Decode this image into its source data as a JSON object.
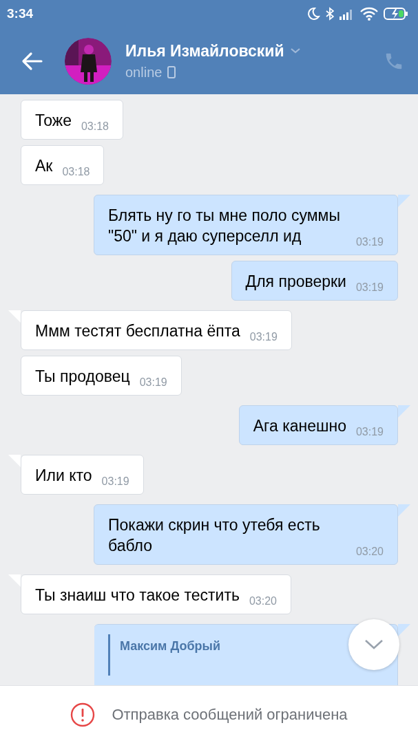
{
  "status_bar": {
    "time": "3:34"
  },
  "header": {
    "name": "Илья Измайловский",
    "status": "online"
  },
  "messages": [
    {
      "kind": "in",
      "text": "Тоже",
      "time": "03:18",
      "tail": false
    },
    {
      "kind": "in",
      "text": "Ак",
      "time": "03:18",
      "tail": false
    },
    {
      "kind": "out",
      "text": "Блять ну го ты мне поло суммы \"50\" и я даю суперселл ид",
      "time": "03:19",
      "tail": true
    },
    {
      "kind": "out",
      "text": "Для проверки",
      "time": "03:19",
      "tail": false
    },
    {
      "kind": "in",
      "text": "Ммм тестят бесплатна ёпта",
      "time": "03:19",
      "tail": true
    },
    {
      "kind": "in",
      "text": "Ты продовец",
      "time": "03:19",
      "tail": false
    },
    {
      "kind": "out",
      "text": "Ага канешно",
      "time": "03:19",
      "tail": true
    },
    {
      "kind": "in",
      "text": "Или кто",
      "time": "03:19",
      "tail": true
    },
    {
      "kind": "out",
      "text": "Покажи скрин что утебя есть бабло",
      "time": "03:20",
      "tail": true
    },
    {
      "kind": "in",
      "text": "Ты знаиш что такое тестить",
      "time": "03:20",
      "tail": true
    },
    {
      "kind": "quote",
      "author": "Максим Добрый",
      "tail": true
    }
  ],
  "notice": "Отправка сообщений ограничена"
}
